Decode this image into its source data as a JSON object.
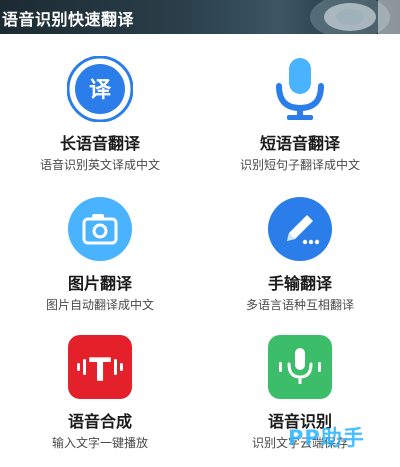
{
  "banner": {
    "title": "语音识别快速翻译"
  },
  "features": [
    {
      "title": "长语音翻译",
      "desc": "语音识别英文译成中文",
      "icon": "translate-icon"
    },
    {
      "title": "短语音翻译",
      "desc": "识别短句子翻译成中文",
      "icon": "microphone-icon"
    },
    {
      "title": "图片翻译",
      "desc": "图片自动翻译成中文",
      "icon": "camera-icon"
    },
    {
      "title": "手输翻译",
      "desc": "多语言语种互相翻译",
      "icon": "pen-icon"
    },
    {
      "title": "语音合成",
      "desc": "输入文字一键播放",
      "icon": "text-to-speech-icon"
    },
    {
      "title": "语音识别",
      "desc": "识别文字云端保存",
      "icon": "voice-recognition-icon"
    }
  ],
  "icon_glyphs": {
    "translate": "译",
    "tts": "T"
  },
  "colors": {
    "blue": "#2b7de9",
    "light_blue": "#4ab3ff",
    "red": "#e4202a",
    "green": "#3cbd6a"
  },
  "watermark": {
    "text": "PP助手"
  }
}
